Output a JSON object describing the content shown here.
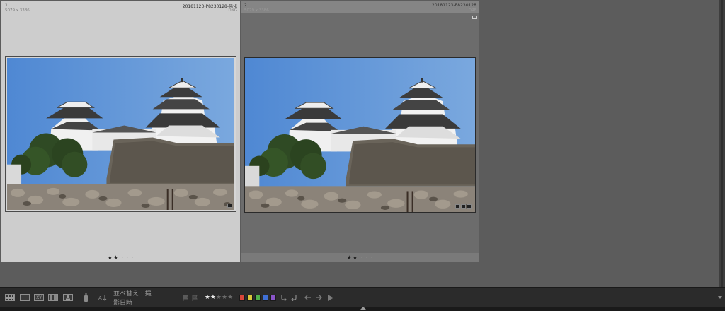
{
  "grid": {
    "cells": [
      {
        "index": "1",
        "dimensions": "5079 x 3386",
        "filename": "20181123-P8230128-強化",
        "extension": "DNG",
        "rating_filled": "★★",
        "rating_empty": "· · ·",
        "rating": 2
      },
      {
        "index": "2",
        "dimensions": "5079 x 3386",
        "filename": "20181123-P8230128",
        "extension": "ORF",
        "rating_filled": "★★",
        "rating_empty": "· · ·",
        "rating": 2
      }
    ]
  },
  "toolbar": {
    "sort_label": "並べ替え : 撮影日時",
    "stars_on": "★★",
    "stars_off": "★★★",
    "rating": 2,
    "color_labels": [
      "#d9453a",
      "#d9c63a",
      "#4fb04a",
      "#3f6fd6",
      "#8a55c9"
    ]
  },
  "icons": {
    "view_grid": "grid-icon",
    "view_loupe": "loupe-icon",
    "view_compare": "compare-icon",
    "view_survey": "survey-icon",
    "view_people": "people-icon",
    "spray": "painter-icon",
    "sort": "sort-icon",
    "flag_pick": "flag-icon",
    "flag_reject": "reject-flag-icon",
    "rotate_left": "rotate-left-icon",
    "rotate_right": "rotate-right-icon",
    "prev": "arrow-left-icon",
    "next": "arrow-right-icon",
    "play": "play-icon",
    "collapse": "chevron-up-icon"
  }
}
